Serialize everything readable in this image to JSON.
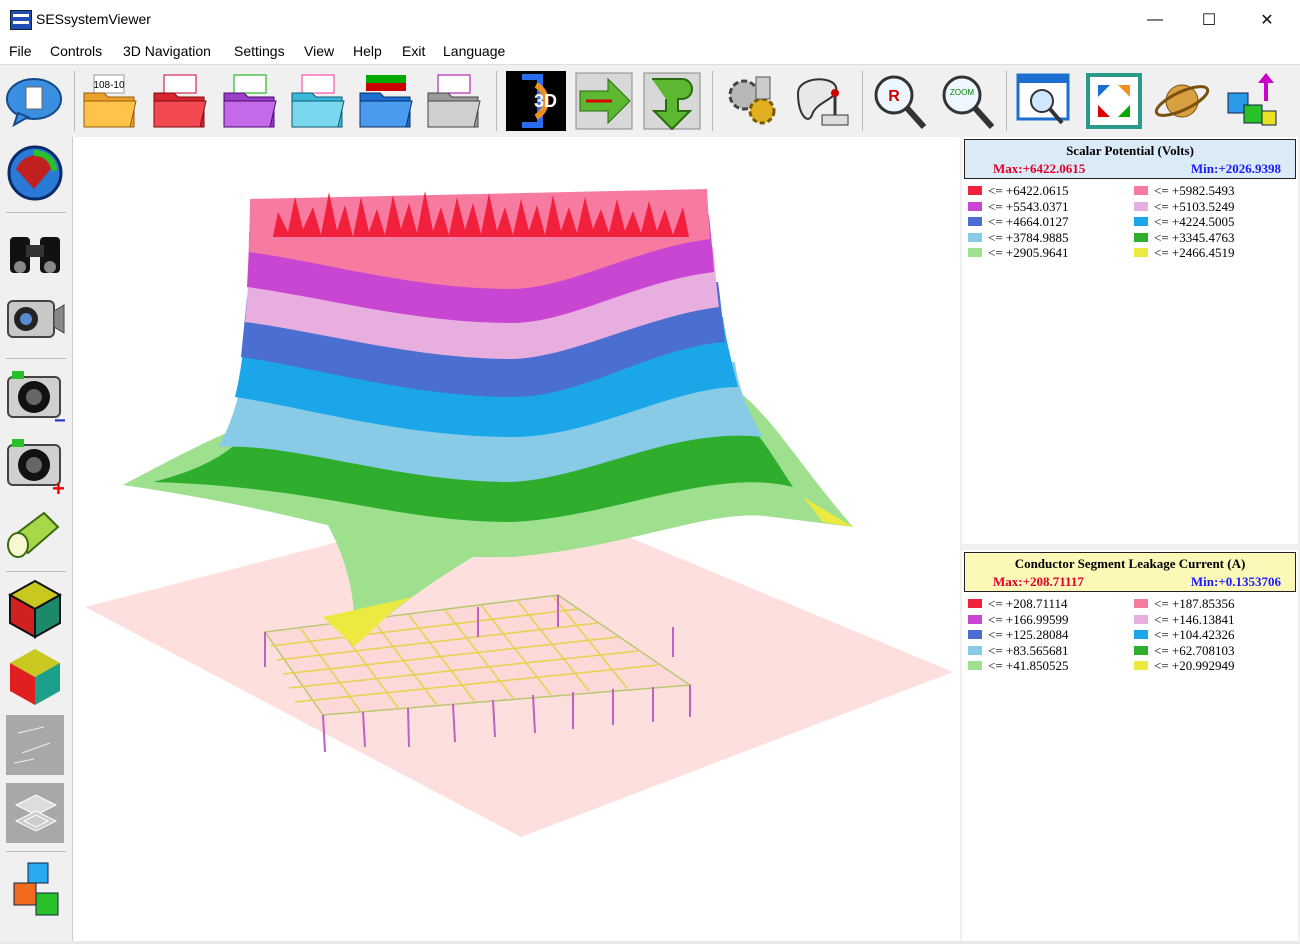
{
  "window": {
    "title": "SESsystemViewer",
    "controls": {
      "minimize": "—",
      "maximize": "☐",
      "close": "✕"
    }
  },
  "menu": [
    "File",
    "Controls",
    "3D Navigation",
    "Settings",
    "View",
    "Help",
    "Exit",
    "Language"
  ],
  "toolbar": {
    "icons": [
      "chat-bubble-document-icon",
      "open-folder-orange-icon",
      "open-folder-red-icon",
      "open-folder-purple-icon",
      "open-folder-cyan-icon",
      "open-folder-blue-icon",
      "open-folder-gray-icon",
      "3d-logo-icon",
      "arrow-right-icon",
      "arrow-down-return-icon",
      "gears-icon",
      "joystick-icon",
      "zoom-reset-icon",
      "zoom-icon",
      "window-search-icon",
      "fit-to-window-icon",
      "saturn-icon",
      "cubes-arrow-icon"
    ],
    "folder_orange_text": "108-10"
  },
  "sidebar": {
    "icons": [
      "globe-render-icon",
      "binoculars-icon",
      "camcorder-icon",
      "camera-zoom-out-icon",
      "camera-zoom-in-icon",
      "flashlight-icon",
      "cube-outline-icon",
      "cube-solid-icon",
      "wireframe-gray-icon",
      "building-gray-icon",
      "stacked-cubes-icon"
    ],
    "zoom_out_sign": "−",
    "zoom_in_sign": "+"
  },
  "legends": [
    {
      "title": "Scalar Potential (Volts)",
      "max": "Max:+6422.0615",
      "min": "Min:+2026.9398",
      "header_bg": "#dbeaf7",
      "items": [
        {
          "color": "#f1203c",
          "label": "<= +6422.0615"
        },
        {
          "color": "#f77aa0",
          "label": "<= +5982.5493"
        },
        {
          "color": "#c946d2",
          "label": "<= +5543.0371"
        },
        {
          "color": "#e8aee0",
          "label": "<= +5103.5249"
        },
        {
          "color": "#4a6fd0",
          "label": "<= +4664.0127"
        },
        {
          "color": "#1aa6e8",
          "label": "<= +4224.5005"
        },
        {
          "color": "#88cbe6",
          "label": "<= +3784.9885"
        },
        {
          "color": "#2fae2e",
          "label": "<= +3345.4763"
        },
        {
          "color": "#9ee08e",
          "label": "<= +2905.9641"
        },
        {
          "color": "#ecea40",
          "label": "<= +2466.4519"
        }
      ]
    },
    {
      "title": "Conductor Segment Leakage Current (A)",
      "max": "Max:+208.71117",
      "min": "Min:+0.1353706",
      "header_bg": "#fbf8b8",
      "items": [
        {
          "color": "#f1203c",
          "label": "<= +208.71114"
        },
        {
          "color": "#f77aa0",
          "label": "<= +187.85356"
        },
        {
          "color": "#c946d2",
          "label": "<= +166.99599"
        },
        {
          "color": "#e8aee0",
          "label": "<= +146.13841"
        },
        {
          "color": "#4a6fd0",
          "label": "<= +125.28084"
        },
        {
          "color": "#1aa6e8",
          "label": "<= +104.42326"
        },
        {
          "color": "#88cbe6",
          "label": "<= +83.565681"
        },
        {
          "color": "#2fae2e",
          "label": "<= +62.708103"
        },
        {
          "color": "#9ee08e",
          "label": "<= +41.850525"
        },
        {
          "color": "#ecea40",
          "label": "<= +20.992949"
        }
      ]
    }
  ]
}
